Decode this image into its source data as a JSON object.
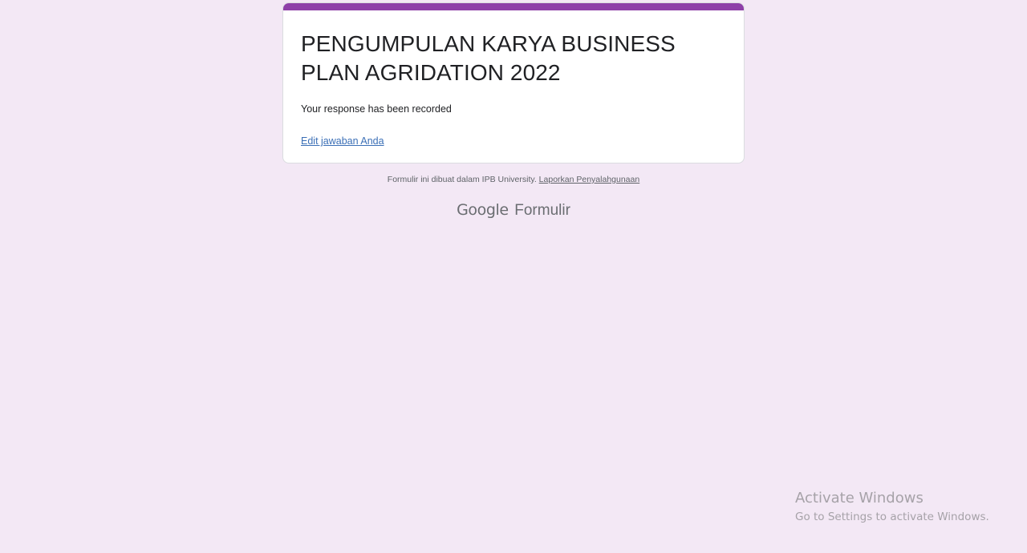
{
  "form": {
    "title": "PENGUMPULAN KARYA BUSINESS PLAN AGRIDATION 2022",
    "confirmation": "Your response has been recorded",
    "edit_link": "Edit jawaban Anda",
    "accent_color": "#8e3fa8"
  },
  "footer": {
    "note": "Formulir ini dibuat dalam IPB University.",
    "report_link": "Laporkan Penyalahgunaan",
    "brand_google": "Google",
    "brand_product": "Formulir"
  },
  "watermark": {
    "title": "Activate Windows",
    "subtitle": "Go to Settings to activate Windows."
  },
  "colors": {
    "background": "#f3e8f5",
    "card": "#ffffff",
    "link": "#3b6fb6"
  }
}
